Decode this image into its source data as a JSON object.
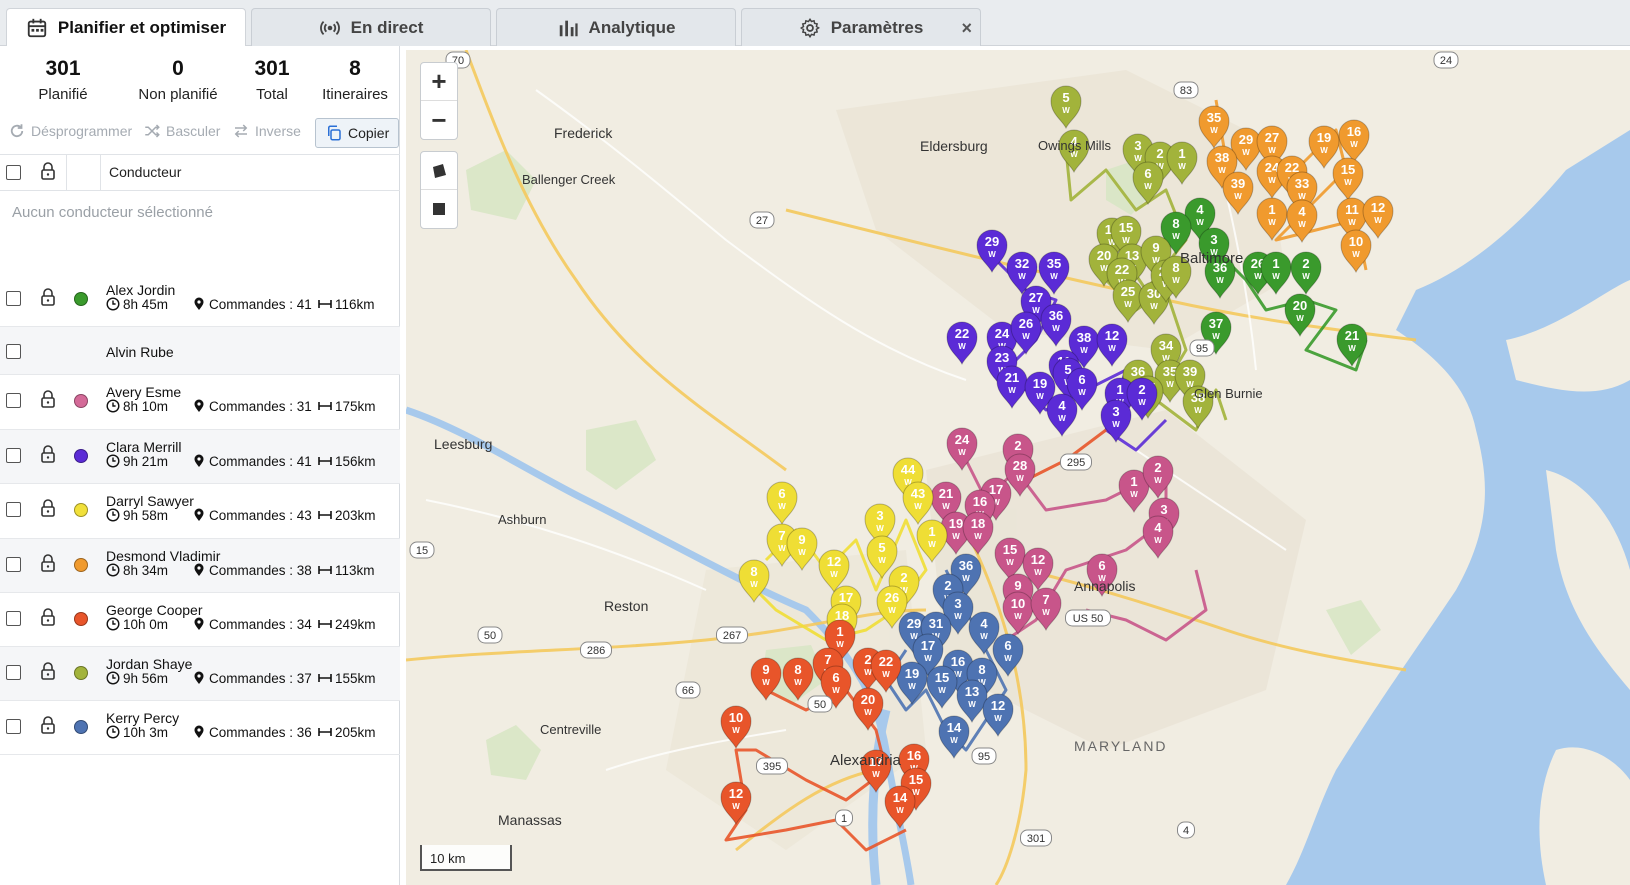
{
  "tabs": [
    {
      "label": "Planifier et optimiser",
      "icon": "calendar-icon",
      "active": true
    },
    {
      "label": "En direct",
      "icon": "broadcast-icon",
      "active": false
    },
    {
      "label": "Analytique",
      "icon": "bar-chart-icon",
      "active": false
    },
    {
      "label": "Paramètres",
      "icon": "gear-icon",
      "active": false
    }
  ],
  "tab_close": "×",
  "stats": [
    {
      "value": "301",
      "label": "Planifié"
    },
    {
      "value": "0",
      "label": "Non planifié"
    },
    {
      "value": "301",
      "label": "Total"
    },
    {
      "value": "8",
      "label": "Itineraires"
    }
  ],
  "actions": {
    "unschedule": "Désprogrammer",
    "toggle": "Basculer",
    "reverse": "Inverse",
    "copy": "Copier"
  },
  "table": {
    "header_driver": "Conducteur",
    "empty_message": "Aucun conducteur sélectionné"
  },
  "drivers": [
    {
      "name": "Alex Jordin",
      "time": "8h 45m",
      "orders": "Commandes : 41",
      "distance": "116km",
      "color": "#3a9a2c"
    },
    {
      "name": "Alvin Rube",
      "time": "",
      "orders": "",
      "distance": "",
      "color": ""
    },
    {
      "name": "Avery Esme",
      "time": "8h 10m",
      "orders": "Commandes : 31",
      "distance": "175km",
      "color": "#d46a98"
    },
    {
      "name": "Clara Merrill",
      "time": "9h 21m",
      "orders": "Commandes : 41",
      "distance": "156km",
      "color": "#5b2bd6"
    },
    {
      "name": "Darryl Sawyer",
      "time": "9h 58m",
      "orders": "Commandes : 43",
      "distance": "203km",
      "color": "#f1e03a"
    },
    {
      "name": "Desmond Vladimir",
      "time": "8h 34m",
      "orders": "Commandes : 38",
      "distance": "113km",
      "color": "#f09a2e"
    },
    {
      "name": "George Cooper",
      "time": "10h 0m",
      "orders": "Commandes : 34",
      "distance": "249km",
      "color": "#e8552a"
    },
    {
      "name": "Jordan Shaye",
      "time": "9h 56m",
      "orders": "Commandes : 37",
      "distance": "155km",
      "color": "#a2b33b"
    },
    {
      "name": "Kerry Percy",
      "time": "10h 3m",
      "orders": "Commandes : 36",
      "distance": "205km",
      "color": "#4e73b2"
    }
  ],
  "map": {
    "zoom_in": "+",
    "zoom_out": "−",
    "scale": "10 km",
    "places": [
      "Frederick",
      "Eldersburg",
      "Ballenger Creek",
      "Owings Mills",
      "Leesburg",
      "Ashburn",
      "Reston",
      "Centreville",
      "Manassas",
      "Annapolis",
      "MARYLAND",
      "Alexandria",
      "Glen Burnie",
      "Baltimore"
    ],
    "route_colors": {
      "green": "#3a9a2c",
      "olive": "#a2b33b",
      "orange": "#f09a2e",
      "purple": "#5b2bd6",
      "pink": "#c8558a",
      "yellow": "#efde35",
      "red": "#e8552a",
      "blue": "#4e73b2"
    },
    "markers": [
      {
        "c": "olive",
        "n": "5"
      },
      {
        "c": "olive",
        "n": "4"
      },
      {
        "c": "olive",
        "n": "3"
      },
      {
        "c": "olive",
        "n": "2"
      },
      {
        "c": "olive",
        "n": "1"
      },
      {
        "c": "olive",
        "n": "6"
      },
      {
        "c": "orange",
        "n": "35"
      },
      {
        "c": "orange",
        "n": "29"
      },
      {
        "c": "orange",
        "n": "38"
      },
      {
        "c": "orange",
        "n": "27"
      },
      {
        "c": "orange",
        "n": "19"
      },
      {
        "c": "orange",
        "n": "16"
      },
      {
        "c": "orange",
        "n": "24"
      },
      {
        "c": "orange",
        "n": "22"
      },
      {
        "c": "orange",
        "n": "15"
      },
      {
        "c": "orange",
        "n": "39"
      },
      {
        "c": "orange",
        "n": "33"
      },
      {
        "c": "orange",
        "n": "1"
      },
      {
        "c": "orange",
        "n": "4"
      },
      {
        "c": "orange",
        "n": "11"
      },
      {
        "c": "orange",
        "n": "12"
      },
      {
        "c": "orange",
        "n": "10"
      },
      {
        "c": "green",
        "n": "4"
      },
      {
        "c": "green",
        "n": "8"
      },
      {
        "c": "green",
        "n": "3"
      },
      {
        "c": "green",
        "n": "36"
      },
      {
        "c": "green",
        "n": "26"
      },
      {
        "c": "green",
        "n": "1"
      },
      {
        "c": "green",
        "n": "2"
      },
      {
        "c": "green",
        "n": "20"
      },
      {
        "c": "green",
        "n": "37"
      },
      {
        "c": "green",
        "n": "21"
      },
      {
        "c": "olive",
        "n": "17"
      },
      {
        "c": "olive",
        "n": "15"
      },
      {
        "c": "olive",
        "n": "20"
      },
      {
        "c": "olive",
        "n": "13"
      },
      {
        "c": "olive",
        "n": "9"
      },
      {
        "c": "olive",
        "n": "22"
      },
      {
        "c": "olive",
        "n": "25"
      },
      {
        "c": "olive",
        "n": "30"
      },
      {
        "c": "olive",
        "n": "29"
      },
      {
        "c": "olive",
        "n": "34"
      },
      {
        "c": "olive",
        "n": "36"
      },
      {
        "c": "olive",
        "n": "35"
      },
      {
        "c": "olive",
        "n": "37"
      },
      {
        "c": "olive",
        "n": "39"
      },
      {
        "c": "olive",
        "n": "38"
      },
      {
        "c": "olive",
        "n": "8"
      },
      {
        "c": "purple",
        "n": "29"
      },
      {
        "c": "purple",
        "n": "32"
      },
      {
        "c": "purple",
        "n": "35"
      },
      {
        "c": "purple",
        "n": "27"
      },
      {
        "c": "purple",
        "n": "36"
      },
      {
        "c": "purple",
        "n": "22"
      },
      {
        "c": "purple",
        "n": "24"
      },
      {
        "c": "purple",
        "n": "26"
      },
      {
        "c": "purple",
        "n": "38"
      },
      {
        "c": "purple",
        "n": "12"
      },
      {
        "c": "purple",
        "n": "23"
      },
      {
        "c": "purple",
        "n": "11"
      },
      {
        "c": "purple",
        "n": "21"
      },
      {
        "c": "purple",
        "n": "19"
      },
      {
        "c": "purple",
        "n": "5"
      },
      {
        "c": "purple",
        "n": "6"
      },
      {
        "c": "purple",
        "n": "4"
      },
      {
        "c": "purple",
        "n": "1"
      },
      {
        "c": "purple",
        "n": "2"
      },
      {
        "c": "purple",
        "n": "3"
      },
      {
        "c": "pink",
        "n": "24"
      },
      {
        "c": "pink",
        "n": "2"
      },
      {
        "c": "pink",
        "n": "28"
      },
      {
        "c": "pink",
        "n": "17"
      },
      {
        "c": "pink",
        "n": "21"
      },
      {
        "c": "pink",
        "n": "16"
      },
      {
        "c": "pink",
        "n": "19"
      },
      {
        "c": "pink",
        "n": "18"
      },
      {
        "c": "pink",
        "n": "1"
      },
      {
        "c": "pink",
        "n": "2"
      },
      {
        "c": "pink",
        "n": "3"
      },
      {
        "c": "pink",
        "n": "4"
      },
      {
        "c": "pink",
        "n": "15"
      },
      {
        "c": "pink",
        "n": "12"
      },
      {
        "c": "pink",
        "n": "9"
      },
      {
        "c": "pink",
        "n": "10"
      },
      {
        "c": "pink",
        "n": "7"
      },
      {
        "c": "pink",
        "n": "6"
      },
      {
        "c": "yellow",
        "n": "44"
      },
      {
        "c": "yellow",
        "n": "43"
      },
      {
        "c": "yellow",
        "n": "6"
      },
      {
        "c": "yellow",
        "n": "3"
      },
      {
        "c": "yellow",
        "n": "1"
      },
      {
        "c": "yellow",
        "n": "7"
      },
      {
        "c": "yellow",
        "n": "9"
      },
      {
        "c": "yellow",
        "n": "5"
      },
      {
        "c": "yellow",
        "n": "12"
      },
      {
        "c": "yellow",
        "n": "8"
      },
      {
        "c": "yellow",
        "n": "2"
      },
      {
        "c": "yellow",
        "n": "17"
      },
      {
        "c": "yellow",
        "n": "26"
      },
      {
        "c": "yellow",
        "n": "18"
      },
      {
        "c": "blue",
        "n": "36"
      },
      {
        "c": "blue",
        "n": "2"
      },
      {
        "c": "blue",
        "n": "3"
      },
      {
        "c": "blue",
        "n": "29"
      },
      {
        "c": "blue",
        "n": "31"
      },
      {
        "c": "blue",
        "n": "4"
      },
      {
        "c": "blue",
        "n": "17"
      },
      {
        "c": "blue",
        "n": "6"
      },
      {
        "c": "blue",
        "n": "16"
      },
      {
        "c": "blue",
        "n": "8"
      },
      {
        "c": "blue",
        "n": "19"
      },
      {
        "c": "blue",
        "n": "15"
      },
      {
        "c": "blue",
        "n": "13"
      },
      {
        "c": "blue",
        "n": "12"
      },
      {
        "c": "blue",
        "n": "14"
      },
      {
        "c": "red",
        "n": "1"
      },
      {
        "c": "red",
        "n": "7"
      },
      {
        "c": "red",
        "n": "2"
      },
      {
        "c": "red",
        "n": "22"
      },
      {
        "c": "red",
        "n": "9"
      },
      {
        "c": "red",
        "n": "8"
      },
      {
        "c": "red",
        "n": "6"
      },
      {
        "c": "red",
        "n": "20"
      },
      {
        "c": "red",
        "n": "10"
      },
      {
        "c": "red",
        "n": "17"
      },
      {
        "c": "red",
        "n": "16"
      },
      {
        "c": "red",
        "n": "15"
      },
      {
        "c": "red",
        "n": "14"
      },
      {
        "c": "red",
        "n": "12"
      }
    ],
    "road_badges": [
      "70",
      "83",
      "24",
      "27",
      "295",
      "15",
      "267",
      "286",
      "50",
      "66",
      "50",
      "395",
      "95",
      "95",
      "US 50",
      "1",
      "4",
      "301"
    ]
  }
}
